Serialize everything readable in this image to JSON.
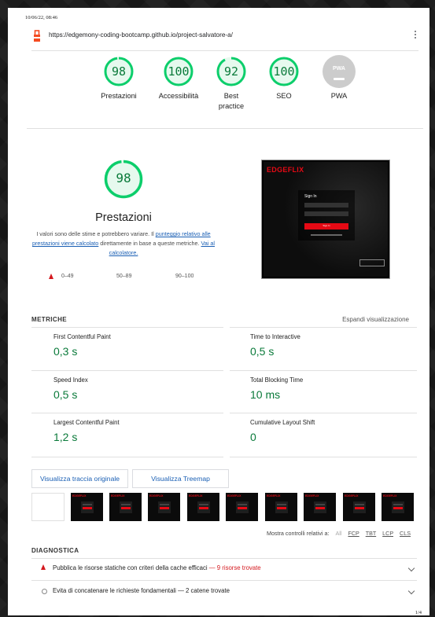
{
  "print_header": {
    "date": "10/06/22, 08:46"
  },
  "address_bar": {
    "url": "https://edgemony-coding-bootcamp.github.io/project-salvatore-a/"
  },
  "gauges": [
    {
      "score": "98",
      "label": "Prestazioni"
    },
    {
      "score": "100",
      "label": "Accessibilità"
    },
    {
      "score": "92",
      "label_line1": "Best",
      "label_line2": "practice"
    },
    {
      "score": "100",
      "label": "SEO"
    },
    {
      "badge": "PWA",
      "label": "PWA"
    }
  ],
  "performance": {
    "score": "98",
    "title": "Prestazioni",
    "desc_1": "I valori sono delle stime e potrebbero variare. Il ",
    "desc_link1": "punteggio relativo alle prestazioni viene calcolato",
    "desc_2": " direttamente in base a queste metriche. ",
    "desc_link2": "Vai al calcolatore.",
    "legend": {
      "low": "0–49",
      "mid": "50–89",
      "high": "90–100"
    }
  },
  "screenshot": {
    "logo": "EDGEFLIX",
    "signin": "Sign In",
    "button": "Sign In"
  },
  "metrics_section": {
    "heading": "METRICHE",
    "expand": "Espandi visualizzazione",
    "items": [
      {
        "name": "First Contentful Paint",
        "value": "0,3 s"
      },
      {
        "name": "Time to Interactive",
        "value": "0,5 s"
      },
      {
        "name": "Speed Index",
        "value": "0,5 s"
      },
      {
        "name": "Total Blocking Time",
        "value": "10 ms"
      },
      {
        "name": "Largest Contentful Paint",
        "value": "1,2 s"
      },
      {
        "name": "Cumulative Layout Shift",
        "value": "0"
      }
    ]
  },
  "buttons": {
    "trace": "Visualizza traccia originale",
    "treemap": "Visualizza Treemap"
  },
  "filmstrip": {
    "logo": "EDGEFLIX"
  },
  "relative": {
    "label": "Mostra controlli relativi a:",
    "all": "All",
    "fcp": "FCP",
    "tbt": "TBT",
    "lcp": "LCP",
    "cls": "CLS"
  },
  "diagnostics": {
    "heading": "DIAGNOSTICA",
    "items": [
      {
        "text": "Pubblica le risorse statiche con criteri della cache efficaci",
        "detail": " — 9 risorse trovate"
      },
      {
        "text": "Evita di concatenare le richieste fondamentali",
        "detail": " — 2 catene trovate"
      }
    ]
  },
  "page_number": "1/4",
  "colors": {
    "pass": "#0cce6b",
    "fail": "#d4191f",
    "link": "#1a5fb4",
    "pwa": "#cccccc"
  }
}
